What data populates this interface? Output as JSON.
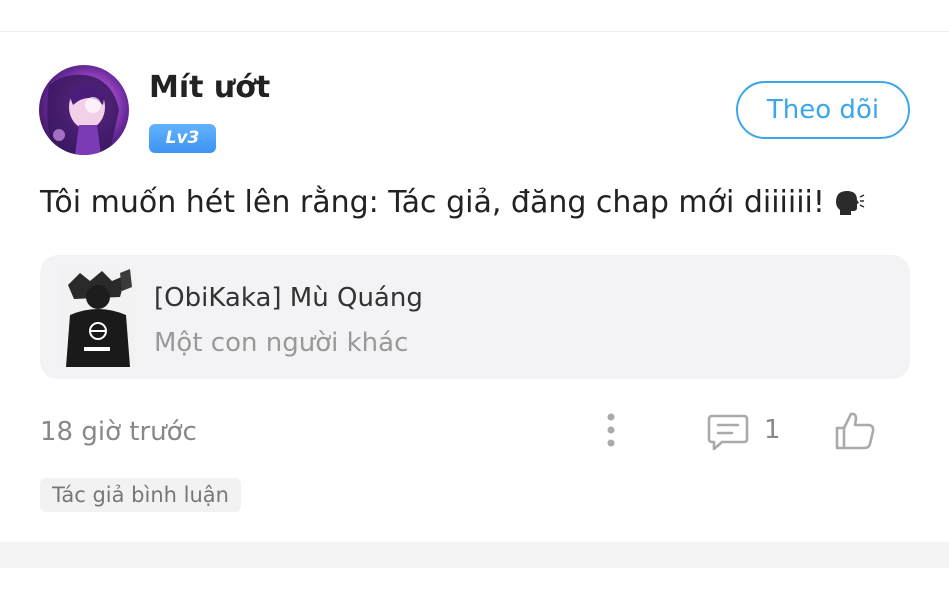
{
  "comment": {
    "username": "Mít ướt",
    "level": "Lv3",
    "follow_label": "Theo dõi",
    "text": "Tôi muốn hét lên rằng: Tác giả, đăng chap mới diiiiii!",
    "story": {
      "title": "[ObiKaka] Mù Quáng",
      "subtitle": "Một con người khác"
    },
    "timestamp": "18 giờ trước",
    "reply_count": "1",
    "author_tag": "Tác giả bình luận"
  },
  "colors": {
    "accent": "#3ca6ea",
    "level_badge": "#4a9ff5",
    "muted_text": "#888888",
    "card_bg": "#f3f3f5"
  },
  "icons": [
    "avatar-image",
    "speaking-head-icon",
    "more-options-icon",
    "reply-icon",
    "like-icon"
  ]
}
